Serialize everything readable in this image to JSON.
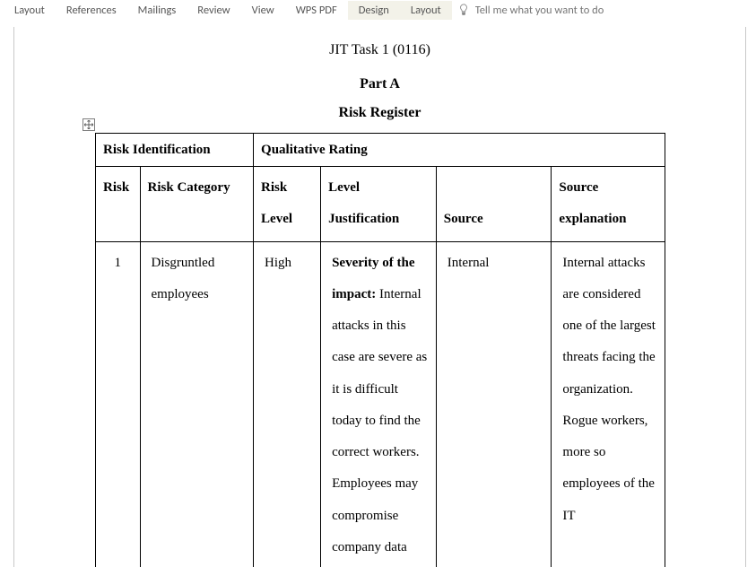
{
  "ribbon": {
    "tabs": [
      {
        "label": "Layout",
        "active": false
      },
      {
        "label": "References",
        "active": false
      },
      {
        "label": "Mailings",
        "active": false
      },
      {
        "label": "Review",
        "active": false
      },
      {
        "label": "View",
        "active": false
      },
      {
        "label": "WPS PDF",
        "active": false
      },
      {
        "label": "Design",
        "active": true
      },
      {
        "label": "Layout",
        "active": true
      }
    ],
    "tell_me_placeholder": "Tell me what you want to do"
  },
  "doc": {
    "title": "JIT Task 1 (0116)",
    "part_a": "Part A",
    "part_a_sub": "Risk Register"
  },
  "table": {
    "group_headers": {
      "risk_ident": "Risk Identification",
      "qual_rating": "Qualitative Rating"
    },
    "headers": {
      "risk": "Risk",
      "risk_category": "Risk Category",
      "risk_level": "Risk Level",
      "level_just": "Level Justification",
      "source": "Source",
      "source_expl": "Source explanation"
    },
    "rows": [
      {
        "risk": "1",
        "category": "Disgruntled employees",
        "level": "High",
        "just_bold": "Severity of the impact:",
        "just_rest": " Internal attacks in this case are severe as it is difficult today to find the correct workers. Employees may compromise company data",
        "source": "Internal",
        "source_expl": "Internal attacks are considered one of the largest threats facing the organization. Rogue workers, more so employees of the IT"
      }
    ]
  }
}
